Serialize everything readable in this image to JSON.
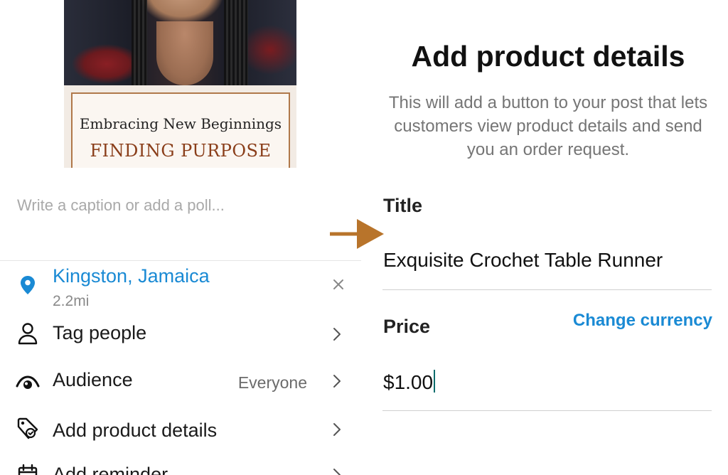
{
  "left_panel": {
    "image": {
      "card_line1": "Embracing New Beginnings",
      "card_line2": "FINDING PURPOSE"
    },
    "caption_placeholder": "Write a caption or add a poll...",
    "location": {
      "name": "Kingston, Jamaica",
      "distance": "2.2mi",
      "icon": "location-pin-icon",
      "color": "#1a8ad4"
    },
    "options": [
      {
        "label": "Tag people",
        "icon": "person-icon",
        "value": ""
      },
      {
        "label": "Audience",
        "icon": "eye-icon",
        "value": "Everyone"
      },
      {
        "label": "Add product details",
        "icon": "product-tag-icon",
        "value": ""
      },
      {
        "label": "Add reminder",
        "icon": "calendar-icon",
        "value": ""
      }
    ]
  },
  "arrow": {
    "color": "#b8742b"
  },
  "right_panel": {
    "heading": "Add product details",
    "description": "This will add a button to your post that lets customers view product details and send you an order request.",
    "title_field": {
      "label": "Title",
      "value": "Exquisite Crochet Table Runner"
    },
    "price_field": {
      "label": "Price",
      "value": "$1.00",
      "change_currency": "Change currency"
    },
    "accent_color": "#1a8ad4"
  }
}
